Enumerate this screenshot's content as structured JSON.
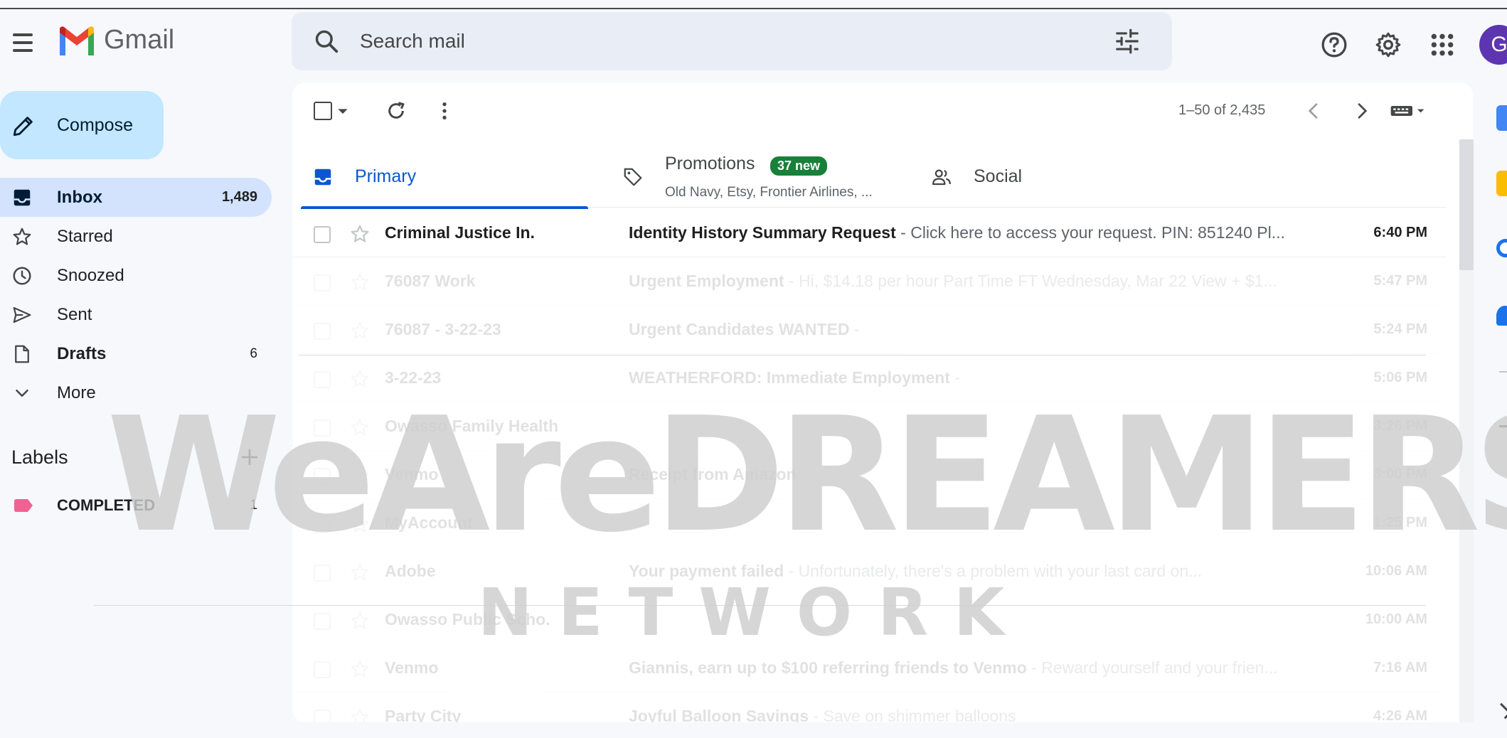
{
  "app": {
    "name": "Gmail",
    "avatar_letter": "G"
  },
  "search": {
    "placeholder": "Search mail"
  },
  "sidebar": {
    "compose_label": "Compose",
    "items": [
      {
        "label": "Inbox",
        "count": "1,489"
      },
      {
        "label": "Starred",
        "count": ""
      },
      {
        "label": "Snoozed",
        "count": ""
      },
      {
        "label": "Sent",
        "count": ""
      },
      {
        "label": "Drafts",
        "count": "6"
      },
      {
        "label": "More",
        "count": ""
      }
    ],
    "labels_heading": "Labels",
    "labels": [
      {
        "name": "COMPLETED",
        "count": "1",
        "color": "#f06292"
      }
    ]
  },
  "toolbar": {
    "pager": "1–50 of 2,435"
  },
  "tabs": [
    {
      "label": "Primary"
    },
    {
      "label": "Promotions",
      "badge": "37 new",
      "sub": "Old Navy, Etsy, Frontier Airlines, ..."
    },
    {
      "label": "Social"
    }
  ],
  "emails": [
    {
      "sender": "Criminal Justice In.",
      "subject": "Identity History Summary Request",
      "snippet": " - Click here to access your request. PIN: 851240 Pl...",
      "time": "6:40 PM"
    },
    {
      "sender": "76087 Work",
      "subject": "Urgent Employment",
      "snippet": " - Hi, $14.18 per hour Part Time FT Wednesday, Mar 22 View + $1...",
      "time": "5:47 PM"
    },
    {
      "sender": "76087 - 3-22-23",
      "subject": "Urgent Candidates WANTED",
      "snippet": " - ",
      "time": "5:24 PM"
    },
    {
      "sender": "3-22-23",
      "subject": "WEATHERFORD: Immediate Employment",
      "snippet": " - ",
      "time": "5:06 PM"
    },
    {
      "sender": "Owasso Family Health",
      "subject": "",
      "snippet": "",
      "time": "3:26 PM"
    },
    {
      "sender": "Venmo",
      "subject": "Receipt from Amazon",
      "snippet": "",
      "time": "3:00 PM"
    },
    {
      "sender": "MyAccount",
      "subject": "",
      "snippet": "",
      "time": "1:25 PM"
    },
    {
      "sender": "Adobe",
      "subject": "Your payment failed",
      "snippet": " - Unfortunately, there's a problem with your last card on...",
      "time": "10:06 AM"
    },
    {
      "sender": "Owasso Public Scho.",
      "subject": "",
      "snippet": "",
      "time": "10:00 AM"
    },
    {
      "sender": "Venmo",
      "subject": "Giannis, earn up to $100 referring friends to Venmo",
      "snippet": " - Reward yourself and your frien...",
      "time": "7:16 AM"
    },
    {
      "sender": "Party City",
      "subject": "Joyful Balloon Savings",
      "snippet": " - Save on shimmer balloons",
      "time": "4:26 AM"
    }
  ],
  "watermark": {
    "title": "WeAreDREAMERS",
    "subtitle": "NETWORK"
  },
  "colors": {
    "accent": "#0b57d0",
    "compose_bg": "#c2e7ff",
    "active_bg": "#d3e3fd",
    "badge": "#188038",
    "avatar": "#5e35b1"
  }
}
